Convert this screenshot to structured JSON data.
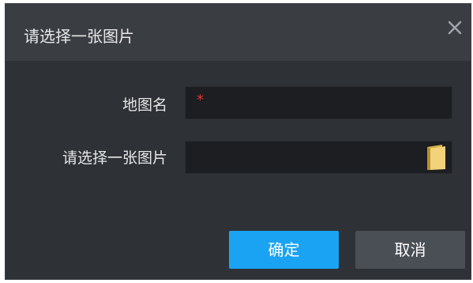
{
  "dialog": {
    "title": "请选择一张图片",
    "close_icon": "close-icon"
  },
  "form": {
    "map_name_label": "地图名",
    "map_name_required_mark": "*",
    "image_label": "请选择一张图片",
    "folder_icon": "folder-icon"
  },
  "buttons": {
    "ok_label": "确定",
    "cancel_label": "取消"
  },
  "colors": {
    "accent": "#1aa3f2",
    "required": "#e0312f",
    "background": "#2e3136",
    "titlebar": "#3a3d42"
  }
}
